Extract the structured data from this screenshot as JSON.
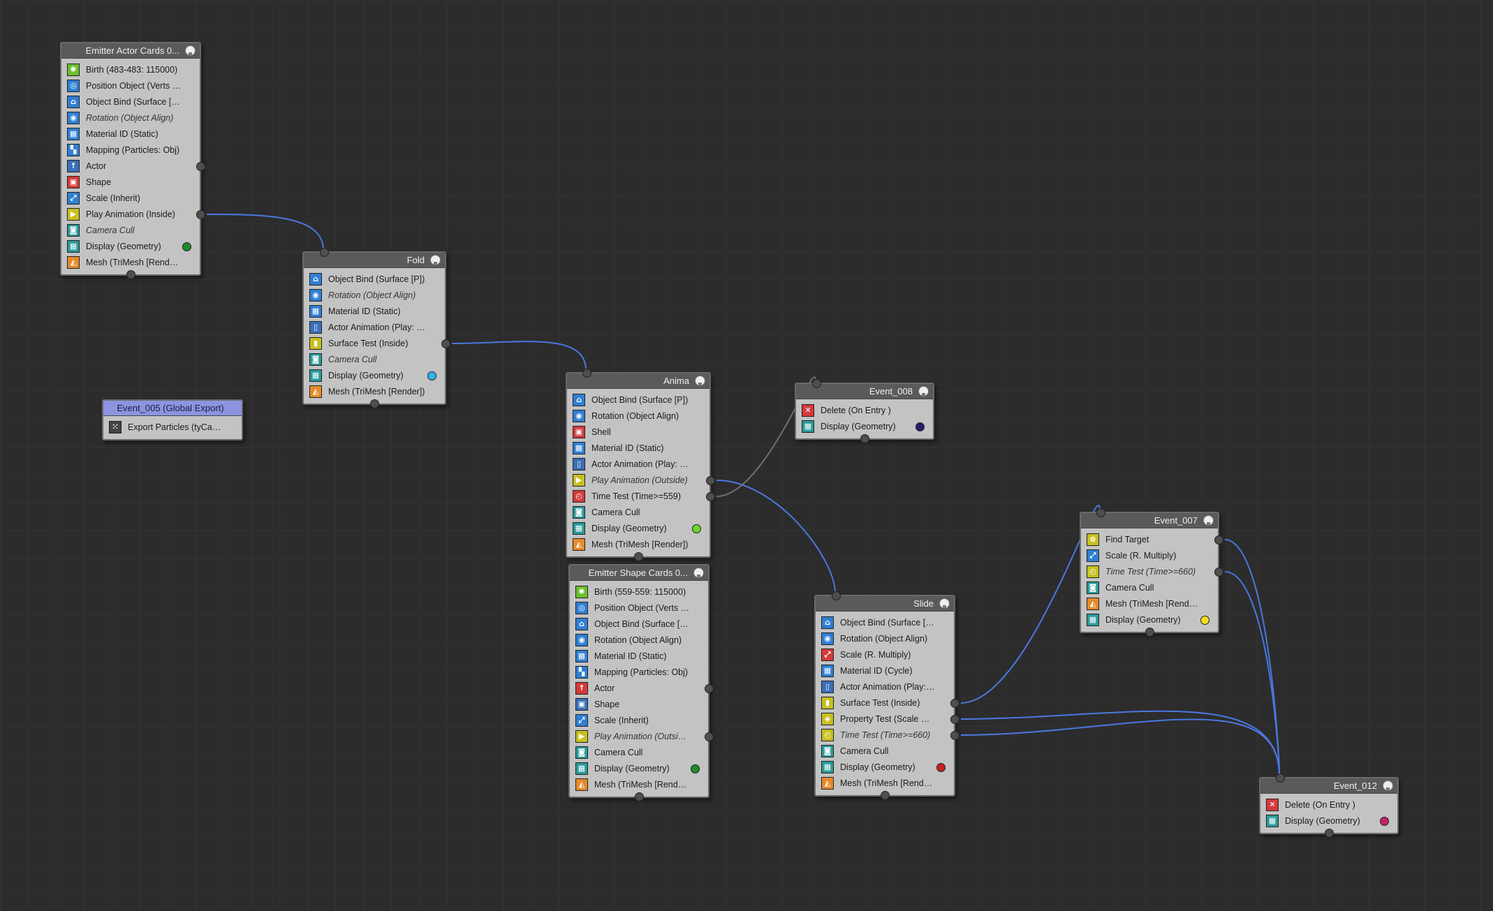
{
  "nodes": {
    "emitter_actor": {
      "title": "Emitter Actor Cards 0...",
      "ops": [
        {
          "label": "Birth (483-483: 115000)",
          "icon": "birth-icon",
          "color": "#6bbf2e"
        },
        {
          "label": "Position Object (Verts (In O...",
          "icon": "position-object-icon",
          "color": "#2f7fd4"
        },
        {
          "label": "Object Bind (Surface [P|S])",
          "icon": "object-bind-icon",
          "color": "#2f7fd4"
        },
        {
          "label": "Rotation (Object Align)",
          "icon": "rotation-icon",
          "color": "#2f7fd4",
          "italic": true
        },
        {
          "label": "Material ID (Static)",
          "icon": "material-id-icon",
          "color": "#2f7fd4"
        },
        {
          "label": "Mapping (Particles: Obj)",
          "icon": "mapping-icon",
          "color": "#2f7fd4"
        },
        {
          "label": "Actor",
          "icon": "actor-icon",
          "color": "#3a6fb8"
        },
        {
          "label": "Shape",
          "icon": "shape-icon",
          "color": "#d53a3a"
        },
        {
          "label": "Scale (Inherit)",
          "icon": "scale-icon",
          "color": "#2f7fd4"
        },
        {
          "label": "Play Animation (Inside)",
          "icon": "play-animation-icon",
          "color": "#c8c020"
        },
        {
          "label": "Camera Cull",
          "icon": "camera-cull-icon",
          "color": "#2a9a9a",
          "italic": true
        },
        {
          "label": "Display (Geometry)",
          "icon": "display-icon",
          "color": "#2a9a9a"
        },
        {
          "label": "Mesh (TriMesh [Render])",
          "icon": "mesh-icon",
          "color": "#e68a2a"
        }
      ],
      "display_color": "#1f8a2a"
    },
    "fold": {
      "title": "Fold",
      "ops": [
        {
          "label": "Object Bind (Surface [P])",
          "icon": "object-bind-icon",
          "color": "#2f7fd4"
        },
        {
          "label": "Rotation (Object Align)",
          "icon": "rotation-icon",
          "color": "#2f7fd4",
          "italic": true
        },
        {
          "label": "Material ID (Static)",
          "icon": "material-id-icon",
          "color": "#2f7fd4"
        },
        {
          "label": "Actor Animation (Play: \"Fol...",
          "icon": "actor-animation-icon",
          "color": "#3a6fb8"
        },
        {
          "label": "Surface Test (Inside)",
          "icon": "surface-test-icon",
          "color": "#c8c020"
        },
        {
          "label": "Camera Cull",
          "icon": "camera-cull-icon",
          "color": "#2a9a9a",
          "italic": true
        },
        {
          "label": "Display (Geometry)",
          "icon": "display-icon",
          "color": "#2a9a9a"
        },
        {
          "label": "Mesh (TriMesh [Render])",
          "icon": "mesh-icon",
          "color": "#e68a2a"
        }
      ],
      "display_color": "#35b0ee"
    },
    "event_005": {
      "title": "Event_005 (Global Export)",
      "ops": [
        {
          "label": "Export Particles (tyCache)",
          "icon": "export-particles-icon",
          "color": "#444444"
        }
      ]
    },
    "anima": {
      "title": "Anima",
      "ops": [
        {
          "label": "Object Bind (Surface [P])",
          "icon": "object-bind-icon",
          "color": "#2f7fd4"
        },
        {
          "label": "Rotation (Object Align)",
          "icon": "rotation-icon",
          "color": "#2f7fd4"
        },
        {
          "label": "Shell",
          "icon": "shell-icon",
          "color": "#d53a3a"
        },
        {
          "label": "Material ID (Static)",
          "icon": "material-id-icon",
          "color": "#2f7fd4"
        },
        {
          "label": "Actor Animation (Play: \"Fol...",
          "icon": "actor-animation-icon",
          "color": "#3a6fb8"
        },
        {
          "label": "Play Animation (Outside)",
          "icon": "play-animation-icon",
          "color": "#c8c020",
          "italic": true
        },
        {
          "label": "Time Test (Time>=559)",
          "icon": "time-test-icon",
          "color": "#d53a3a"
        },
        {
          "label": "Camera Cull",
          "icon": "camera-cull-icon",
          "color": "#2a9a9a"
        },
        {
          "label": "Display (Geometry)",
          "icon": "display-icon",
          "color": "#2a9a9a"
        },
        {
          "label": "Mesh (TriMesh [Render])",
          "icon": "mesh-icon",
          "color": "#e68a2a"
        }
      ],
      "display_color": "#6bd42e"
    },
    "emitter_shape": {
      "title": "Emitter Shape Cards 0...",
      "ops": [
        {
          "label": "Birth (559-559: 115000)",
          "icon": "birth-icon",
          "color": "#6bbf2e"
        },
        {
          "label": "Position Object (Verts (In O...",
          "icon": "position-object-icon",
          "color": "#2f7fd4"
        },
        {
          "label": "Object Bind (Surface [P])",
          "icon": "object-bind-icon",
          "color": "#2f7fd4"
        },
        {
          "label": "Rotation (Object Align)",
          "icon": "rotation-icon",
          "color": "#2f7fd4"
        },
        {
          "label": "Material ID (Static)",
          "icon": "material-id-icon",
          "color": "#2f7fd4"
        },
        {
          "label": "Mapping (Particles: Obj)",
          "icon": "mapping-icon",
          "color": "#2f7fd4"
        },
        {
          "label": "Actor",
          "icon": "actor-icon",
          "color": "#d53a3a"
        },
        {
          "label": "Shape",
          "icon": "shape-icon",
          "color": "#3a6fb8"
        },
        {
          "label": "Scale (Inherit)",
          "icon": "scale-icon",
          "color": "#2f7fd4"
        },
        {
          "label": "Play Animation (Outside)",
          "icon": "play-animation-icon",
          "color": "#c8c020",
          "italic": true
        },
        {
          "label": "Camera Cull",
          "icon": "camera-cull-icon",
          "color": "#2a9a9a"
        },
        {
          "label": "Display (Geometry)",
          "icon": "display-icon",
          "color": "#2a9a9a"
        },
        {
          "label": "Mesh (TriMesh [Render])",
          "icon": "mesh-icon",
          "color": "#e68a2a"
        }
      ],
      "display_color": "#1f8a2a"
    },
    "event_008": {
      "title": "Event_008",
      "ops": [
        {
          "label": "Delete (On Entry )",
          "icon": "delete-icon",
          "color": "#d53a3a"
        },
        {
          "label": "Display (Geometry)",
          "icon": "display-icon",
          "color": "#2a9a9a"
        }
      ],
      "display_color": "#2a1a6a"
    },
    "slide": {
      "title": "Slide",
      "ops": [
        {
          "label": "Object Bind (Surface [P])",
          "icon": "object-bind-icon",
          "color": "#2f7fd4"
        },
        {
          "label": "Rotation (Object Align)",
          "icon": "rotation-icon",
          "color": "#2f7fd4"
        },
        {
          "label": "Scale (R. Multiply)",
          "icon": "scale-icon",
          "color": "#d53a3a"
        },
        {
          "label": "Material ID (Cycle)",
          "icon": "material-id-icon",
          "color": "#2f7fd4"
        },
        {
          "label": "Actor Animation (Play: \"Sli...",
          "icon": "actor-animation-icon",
          "color": "#3a6fb8"
        },
        {
          "label": "Surface Test (Inside)",
          "icon": "surface-test-icon",
          "color": "#c8c020"
        },
        {
          "label": "Property Test (Scale Mag)",
          "icon": "property-test-icon",
          "color": "#c8c020"
        },
        {
          "label": "Time Test (Time>=660)",
          "icon": "time-test-icon",
          "color": "#c8c020",
          "italic": true
        },
        {
          "label": "Camera Cull",
          "icon": "camera-cull-icon",
          "color": "#2a9a9a"
        },
        {
          "label": "Display (Geometry)",
          "icon": "display-icon",
          "color": "#2a9a9a"
        },
        {
          "label": "Mesh (TriMesh [Render])",
          "icon": "mesh-icon",
          "color": "#e68a2a"
        }
      ],
      "display_color": "#c42222"
    },
    "event_007": {
      "title": "Event_007",
      "ops": [
        {
          "label": "Find Target",
          "icon": "find-target-icon",
          "color": "#c8c020"
        },
        {
          "label": "Scale (R. Multiply)",
          "icon": "scale-icon",
          "color": "#2f7fd4"
        },
        {
          "label": "Time Test (Time>=660)",
          "icon": "time-test-icon",
          "color": "#c8c020",
          "italic": true
        },
        {
          "label": "Camera Cull",
          "icon": "camera-cull-icon",
          "color": "#2a9a9a"
        },
        {
          "label": "Mesh (TriMesh [Render])",
          "icon": "mesh-icon",
          "color": "#e68a2a"
        },
        {
          "label": "Display (Geometry)",
          "icon": "display-icon",
          "color": "#2a9a9a"
        }
      ],
      "display_color": "#f0e020"
    },
    "event_012": {
      "title": "Event_012",
      "ops": [
        {
          "label": "Delete (On Entry )",
          "icon": "delete-icon",
          "color": "#d53a3a"
        },
        {
          "label": "Display (Geometry)",
          "icon": "display-icon",
          "color": "#2a9a9a"
        }
      ],
      "display_color": "#c42266"
    }
  },
  "colors": {
    "background": "#2c2c2c",
    "wire_blue": "#4a78e0",
    "wire_gray": "#707070"
  }
}
